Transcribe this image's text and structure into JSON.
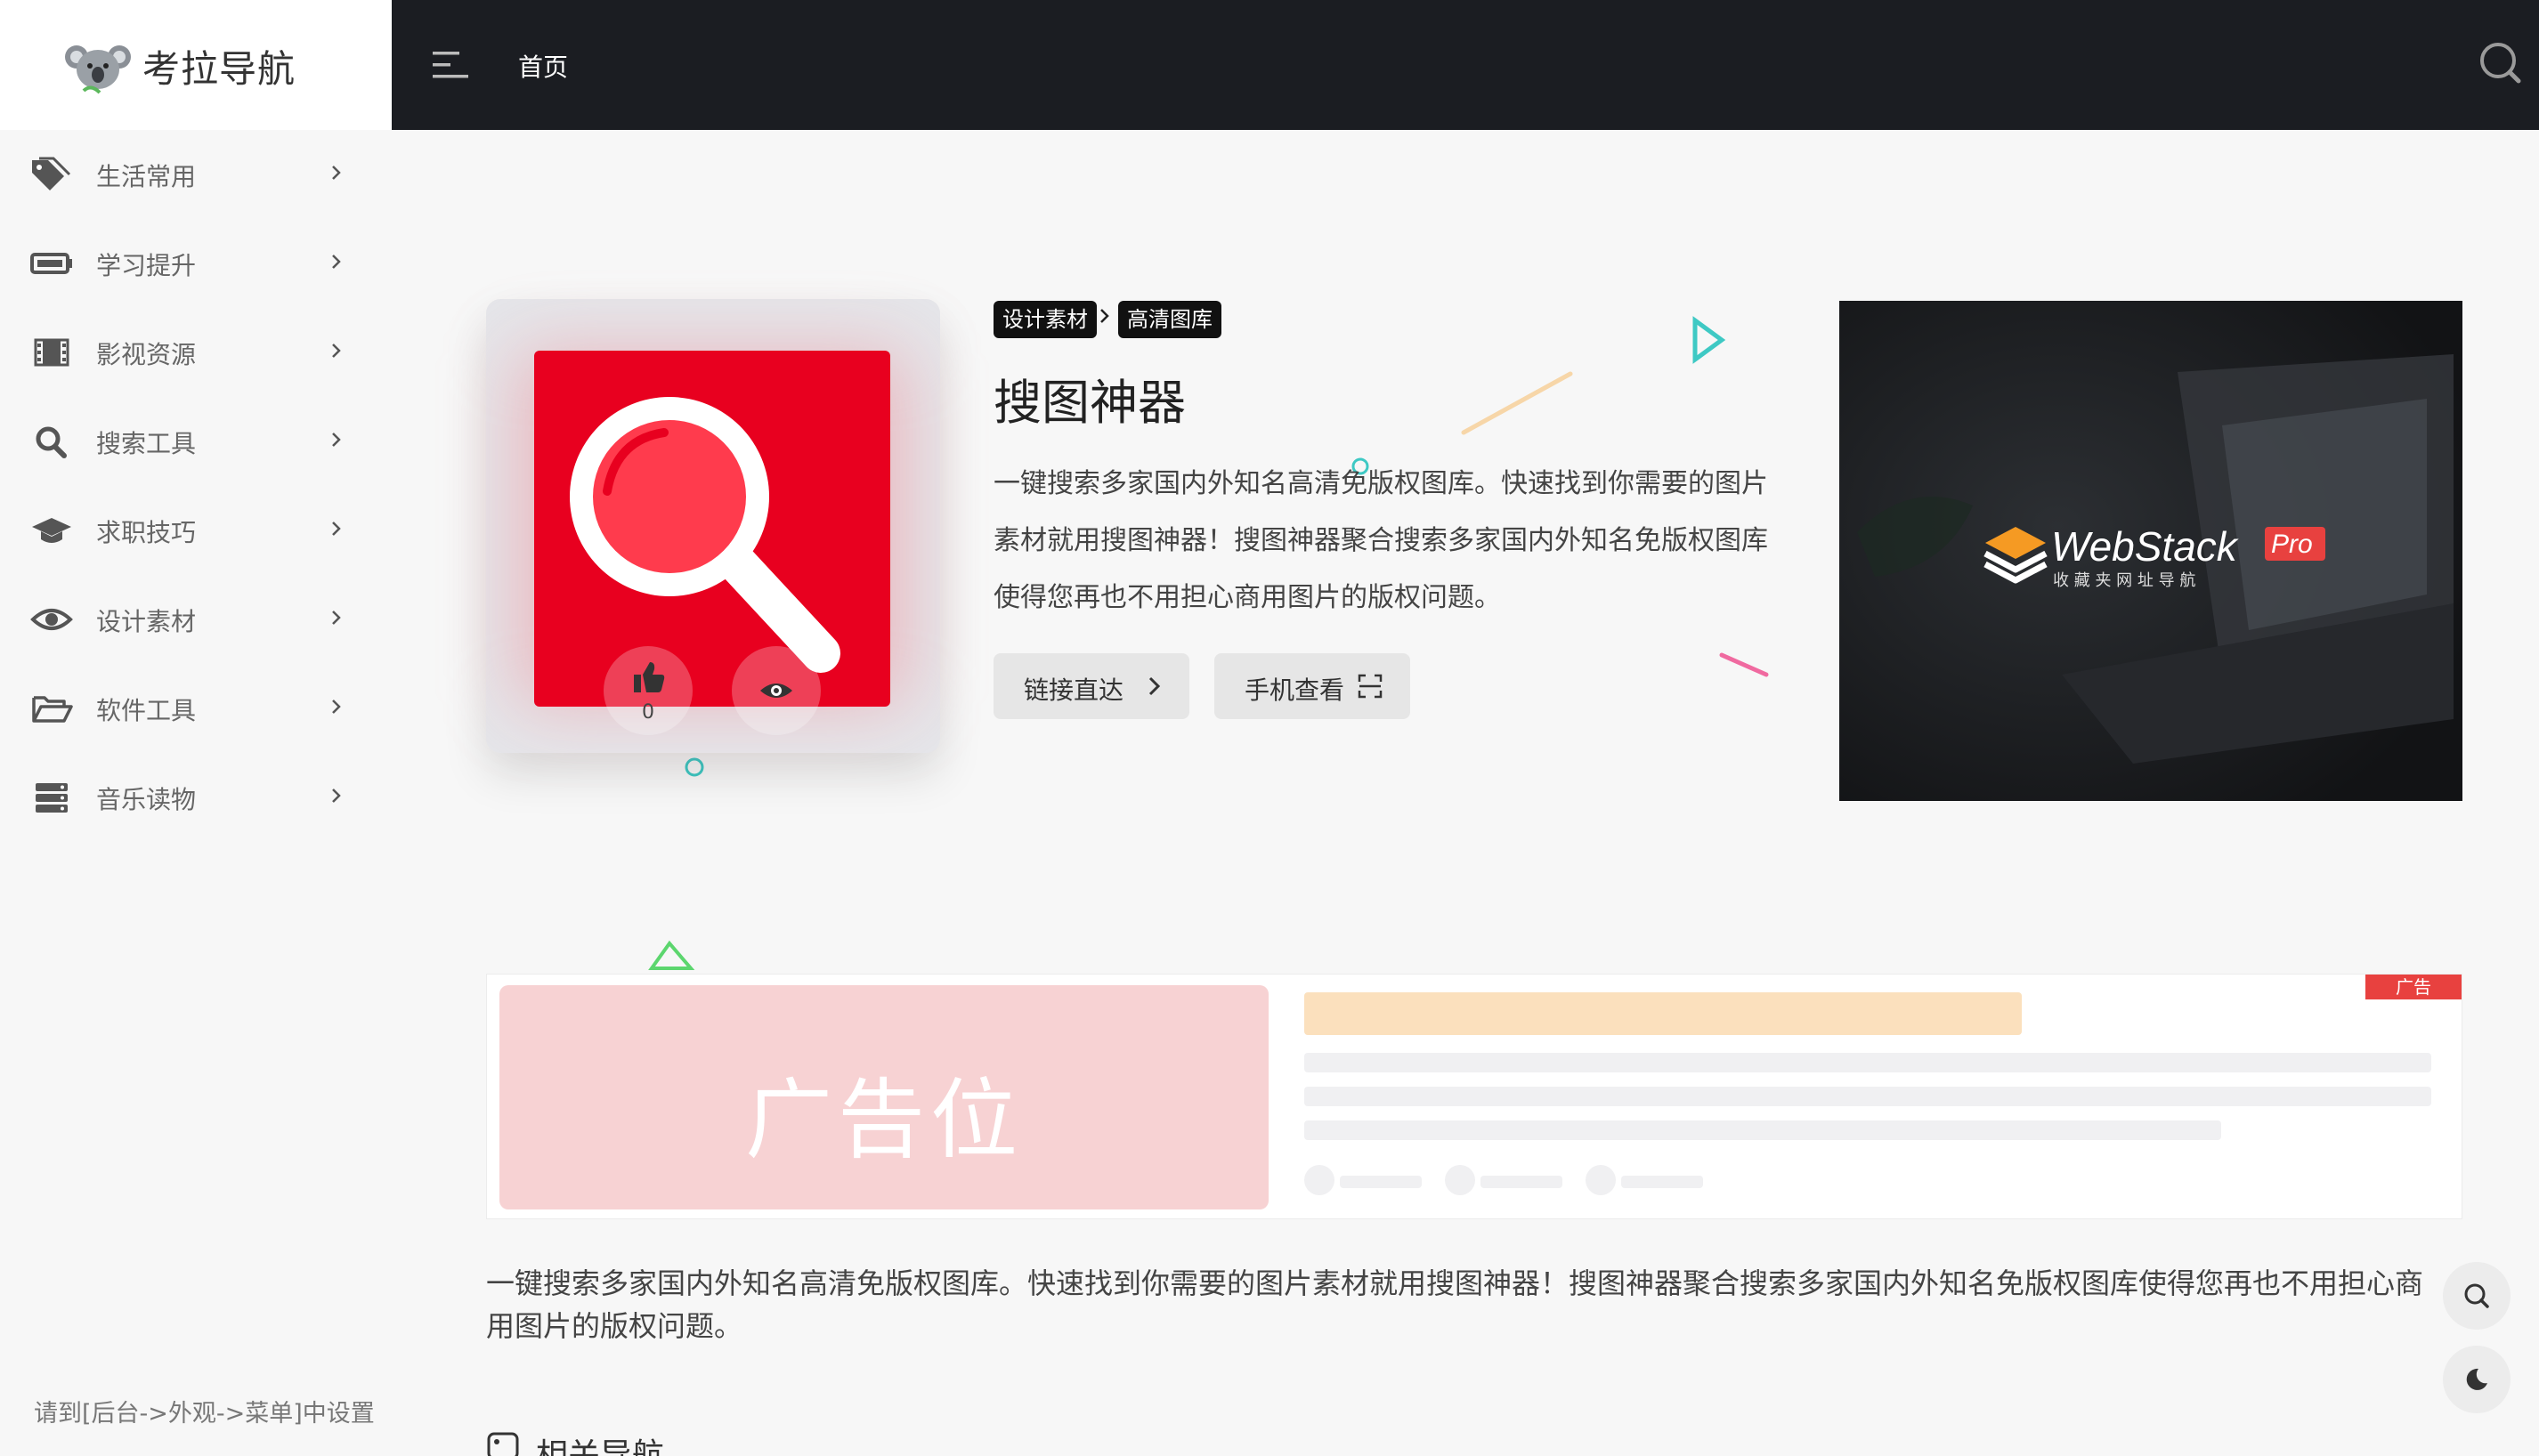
{
  "site": {
    "name": "考拉导航"
  },
  "topbar": {
    "home": "首页"
  },
  "sidebar": {
    "items": [
      {
        "label": "生活常用",
        "icon": "tag-icon"
      },
      {
        "label": "学习提升",
        "icon": "battery-icon"
      },
      {
        "label": "影视资源",
        "icon": "film-icon"
      },
      {
        "label": "搜索工具",
        "icon": "search-icon"
      },
      {
        "label": "求职技巧",
        "icon": "graduation-cap-icon"
      },
      {
        "label": "设计素材",
        "icon": "eye-icon"
      },
      {
        "label": "软件工具",
        "icon": "folder-open-icon"
      },
      {
        "label": "音乐读物",
        "icon": "server-icon"
      }
    ],
    "footer": "请到[后台->外观->菜单]中设置"
  },
  "detail": {
    "tags": [
      "设计素材",
      "高清图库"
    ],
    "title": "搜图神器",
    "description": "一键搜索多家国内外知名高清免版权图库。快速找到你需要的图片素材就用搜图神器！搜图神器聚合搜索多家国内外知名免版权图库使得您再也不用担心商用图片的版权问题。",
    "like_count": "0",
    "buttons": {
      "direct": "链接直达",
      "mobile": "手机查看"
    },
    "screenshot": {
      "brand": "WebStack",
      "badge": "Pro",
      "subtitle": "收 藏 夹 网 址 导 航"
    }
  },
  "ad": {
    "placeholder": "广告位",
    "badge": "广告"
  },
  "content": {
    "long_description": "一键搜索多家国内外知名高清免版权图库。快速找到你需要的图片素材就用搜图神器！搜图神器聚合搜索多家国内外知名免版权图库使得您再也不用担心商用图片的版权问题。",
    "related_title": "相关导航"
  },
  "colors": {
    "topbar": "#1b1d22",
    "accent_red": "#e8001f",
    "ad_badge": "#e8413f",
    "teal": "#3ec9c4"
  }
}
